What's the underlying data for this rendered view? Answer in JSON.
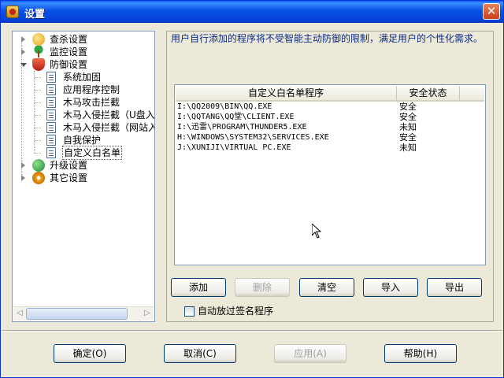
{
  "window": {
    "title": "设置"
  },
  "tree": {
    "items": [
      {
        "label": "查杀设置",
        "icon": "search-icon"
      },
      {
        "label": "监控设置",
        "icon": "umbrella-icon"
      },
      {
        "label": "防御设置",
        "icon": "shield-icon"
      },
      {
        "label": "系统加固",
        "icon": "page-icon"
      },
      {
        "label": "应用程序控制",
        "icon": "page-icon"
      },
      {
        "label": "木马攻击拦截",
        "icon": "page-icon"
      },
      {
        "label": "木马入侵拦截（U盘入侵",
        "icon": "page-icon"
      },
      {
        "label": "木马入侵拦截（网站入",
        "icon": "page-icon"
      },
      {
        "label": "自我保护",
        "icon": "page-icon"
      },
      {
        "label": "自定义白名单",
        "icon": "page-icon"
      },
      {
        "label": "升级设置",
        "icon": "globe-icon"
      },
      {
        "label": "其它设置",
        "icon": "gear-icon"
      }
    ]
  },
  "content": {
    "description": "用户自行添加的程序将不受智能主动防御的限制，满足用户的个性化需求。",
    "columns": [
      "自定义白名单程序",
      "安全状态"
    ],
    "rows": [
      {
        "path": "I:\\QQ2009\\BIN\\QQ.EXE",
        "status": "安全"
      },
      {
        "path": "I:\\QQTANG\\QQ堂\\CLIENT.EXE",
        "status": "安全"
      },
      {
        "path": "I:\\迅雷\\PROGRAM\\THUNDER5.EXE",
        "status": "未知"
      },
      {
        "path": "H:\\WINDOWS\\SYSTEM32\\SERVICES.EXE",
        "status": "安全"
      },
      {
        "path": "J:\\XUNIJI\\VIRTUAL PC.EXE",
        "status": "未知"
      }
    ],
    "buttons": {
      "add": "添加",
      "delete": "删除",
      "clear": "清空",
      "import": "导入",
      "export": "导出"
    },
    "checkbox_label": "自动放过签名程序"
  },
  "footer": {
    "ok": "确定(O)",
    "cancel": "取消(C)",
    "apply": "应用(A)",
    "help": "帮助(H)"
  }
}
